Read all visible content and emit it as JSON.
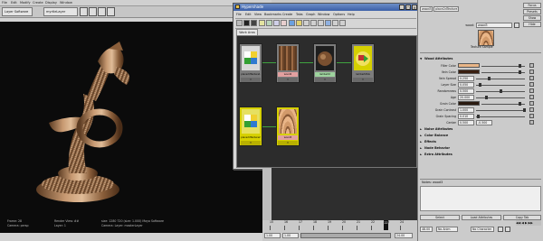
{
  "viewport": {
    "layer_field": "Layer Software",
    "layer_name": "myrtleLayer",
    "menu": [
      "File",
      "Edit",
      "Modify",
      "Create",
      "Display",
      "Window"
    ],
    "hud_left": [
      "Frame: 28",
      "Camera: persp"
    ],
    "hud_mid": [
      "Render View: ##",
      "Layer: 1",
      "Size: 1280 720"
    ],
    "hud_right": [
      "size: 1280 720 (size: 1.000) Maya Software",
      "Camera: Layer: masterLayer"
    ]
  },
  "hypershade": {
    "title": "Hypershade",
    "menu": [
      "File",
      "Edit",
      "View",
      "Bookmarks",
      "Create",
      "Tabs",
      "Graph",
      "Window",
      "Options",
      "Help"
    ],
    "tab": "Work Area",
    "nodes": [
      {
        "name": "place2dTexture1",
        "type": "place2d"
      },
      {
        "name": "wood2",
        "type": "wood"
      },
      {
        "name": "lambert2",
        "type": "lambert"
      },
      {
        "name": "lambert2SG",
        "type": "sg"
      },
      {
        "name": "place2dTexture2",
        "type": "place2d"
      },
      {
        "name": "wood3",
        "type": "wood"
      }
    ]
  },
  "attribute_editor": {
    "tabs": [
      "wood3",
      "place2dTexture1"
    ],
    "node_label": "wood:",
    "node_name": "wood3",
    "buttons": [
      "Focus",
      "Presets",
      "Show",
      "Hide"
    ],
    "sample_label": "Texture Sample",
    "section_title": "Wood Attributes",
    "attributes": [
      {
        "label": "Filler Color",
        "type": "color",
        "color": "#e9b587"
      },
      {
        "label": "Vein Color",
        "type": "color",
        "color": "#3a1f10"
      },
      {
        "label": "Vein Spread",
        "value": "0.250",
        "slider": 0.25
      },
      {
        "label": "Layer Size",
        "value": "0.050",
        "slider": 0.05
      },
      {
        "label": "Randomness",
        "value": "0.500",
        "slider": 0.5
      },
      {
        "label": "Age",
        "value": "20.000",
        "slider": 0.2
      },
      {
        "label": "Grain Color",
        "type": "color",
        "color": "#2a1a10"
      },
      {
        "label": "Grain Contrast",
        "value": "1.000",
        "slider": 1.0
      },
      {
        "label": "Grain Spacing",
        "value": "0.010",
        "slider": 0.02
      },
      {
        "label": "Center",
        "value": "0.500",
        "value2": "-0.500"
      }
    ],
    "collapsed_sections": [
      "Noise Attributes",
      "Color Balance",
      "Effects",
      "Node Behavior",
      "Extra Attributes"
    ],
    "notes_label": "Notes: wood3",
    "bottom_buttons": [
      "Select",
      "Load Attributes",
      "Copy Tab"
    ]
  },
  "timeline": {
    "ticks": [
      "15",
      "16",
      "17",
      "18",
      "19",
      "20",
      "21",
      "22",
      "23",
      "24"
    ],
    "current": "22",
    "range_start": "1.00",
    "range_start2": "1.00",
    "range_end": "24.00",
    "range_end2": "48.00",
    "anim_layer": "No Anim Layer",
    "char_set": "No Character Set"
  },
  "colors": {
    "wood_light": "#d8b088",
    "wood_dark": "#5b3b22",
    "viewport_bg": "#0b0b0b",
    "hs_title": "#3b5fa8",
    "wire_green": "#3fa23f",
    "sg_yellow": "#d6d000"
  }
}
